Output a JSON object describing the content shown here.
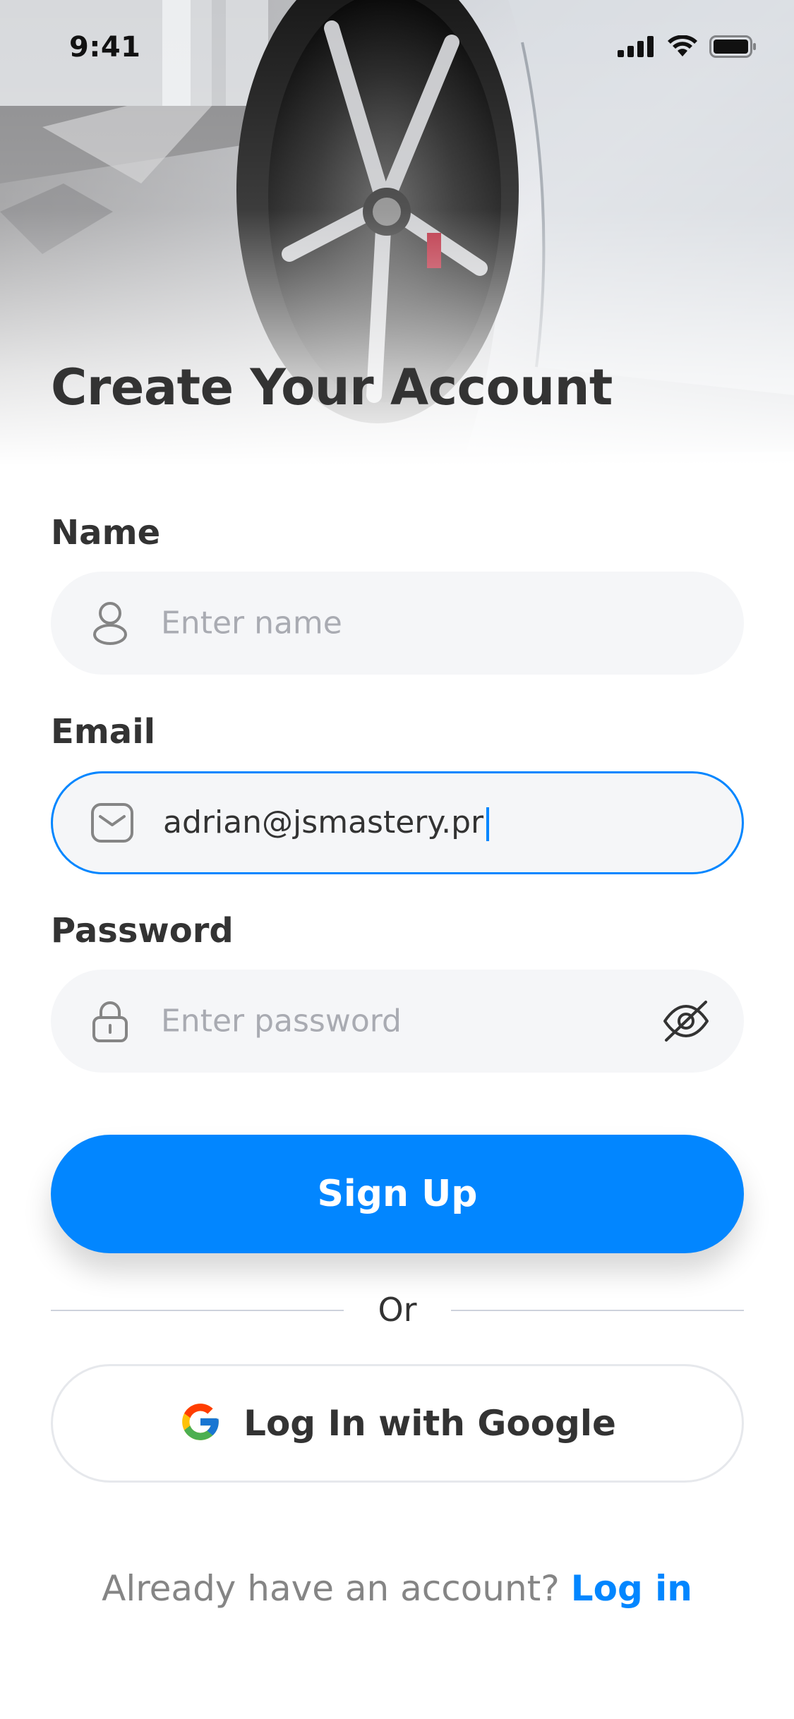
{
  "status_bar": {
    "time": "9:41"
  },
  "title": "Create Your Account",
  "form": {
    "name": {
      "label": "Name",
      "placeholder": "Enter name",
      "icon": "person-icon"
    },
    "email": {
      "label": "Email",
      "value": "adrian@jsmastery.pr",
      "icon": "envelope-icon",
      "focused": true
    },
    "password": {
      "label": "Password",
      "placeholder": "Enter password",
      "icon": "lock-icon",
      "toggle_icon": "eye-off-icon"
    }
  },
  "buttons": {
    "sign_up": "Sign Up",
    "divider_text": "Or",
    "google": "Log In with Google"
  },
  "footer": {
    "prompt": "Already have an account?",
    "link": "Log in"
  },
  "colors": {
    "primary": "#0286ff",
    "text": "#333333",
    "muted": "#858585",
    "input_bg": "#f5f6f8"
  }
}
